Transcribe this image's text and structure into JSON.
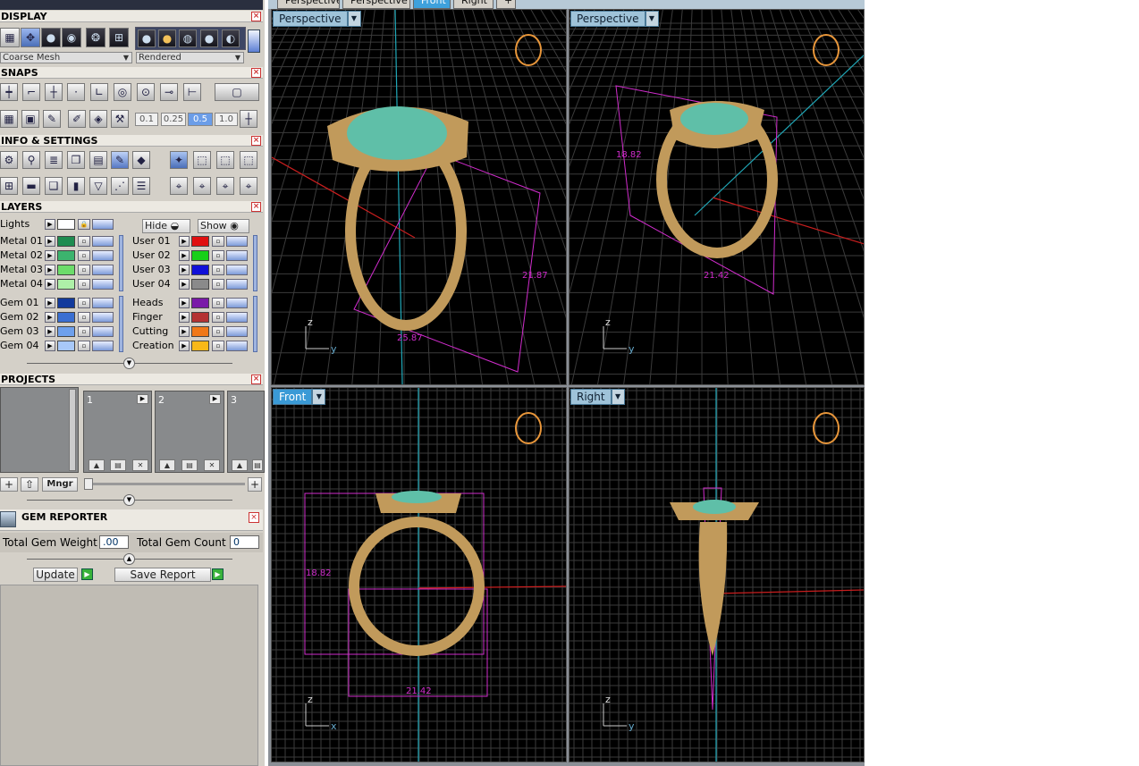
{
  "panels": {
    "display": "DISPLAY",
    "snaps": "SNAPS",
    "info": "INFO & SETTINGS",
    "layers": "LAYERS",
    "projects": "PROJECTS",
    "gem_reporter": "GEM REPORTER",
    "close": "×"
  },
  "display": {
    "mesh_select": "Coarse Mesh",
    "render_select": "Rendered"
  },
  "snaps": {
    "values": [
      "0.1",
      "0.25",
      "0.5",
      "1.0"
    ],
    "selected": "0.5"
  },
  "layers": {
    "lights_label": "Lights",
    "hide": "Hide",
    "show": "Show",
    "left": [
      {
        "name": "Metal 01",
        "color": "#1e8c50"
      },
      {
        "name": "Metal 02",
        "color": "#3cb46e"
      },
      {
        "name": "Metal 03",
        "color": "#6cdc6a"
      },
      {
        "name": "Metal 04",
        "color": "#aef0a8"
      },
      {
        "name": "Gem 01",
        "color": "#123a9c"
      },
      {
        "name": "Gem 02",
        "color": "#3a6fd2"
      },
      {
        "name": "Gem 03",
        "color": "#6ea0ec"
      },
      {
        "name": "Gem 04",
        "color": "#a8c8f8"
      }
    ],
    "right": [
      {
        "name": "User 01",
        "color": "#e01010"
      },
      {
        "name": "User 02",
        "color": "#18d018"
      },
      {
        "name": "User 03",
        "color": "#1010d8"
      },
      {
        "name": "User 04",
        "color": "#8a8a8a"
      },
      {
        "name": "Heads",
        "color": "#7a1aa8"
      },
      {
        "name": "Finger",
        "color": "#b43232"
      },
      {
        "name": "Cutting",
        "color": "#f07818"
      },
      {
        "name": "Creation",
        "color": "#f8b818"
      }
    ]
  },
  "projects": {
    "slots": [
      "1",
      "2",
      "3"
    ],
    "mngr": "Mngr",
    "plus": "+"
  },
  "gem_reporter": {
    "total_weight_label": "Total Gem Weight",
    "total_weight_value": ".00",
    "total_count_label": "Total Gem Count",
    "total_count_value": "0",
    "update": "Update",
    "save_report": "Save Report"
  },
  "tabs": [
    {
      "label": "Perspective",
      "active": false
    },
    {
      "label": "Perspective",
      "active": false
    },
    {
      "label": "Front",
      "active": true
    },
    {
      "label": "Right",
      "active": false
    },
    {
      "label": "+",
      "active": false
    }
  ],
  "viewports": [
    {
      "label": "Perspective",
      "active": false,
      "dims": [
        "21.87",
        "25.87"
      ],
      "axes": {
        "up": "z",
        "side": "y"
      }
    },
    {
      "label": "Perspective",
      "active": false,
      "dims": [
        "18.82",
        "21.42"
      ],
      "axes": {
        "up": "z",
        "side": "y"
      }
    },
    {
      "label": "Front",
      "active": true,
      "dims": [
        "18.82",
        "21.42"
      ],
      "axes": {
        "up": "z",
        "side": "x"
      }
    },
    {
      "label": "Right",
      "active": false,
      "dims": [],
      "axes": {
        "up": "z",
        "side": "y"
      }
    }
  ],
  "colors": {
    "metal": "#c19a5b",
    "gem": "#5fbfa8",
    "dimension": "#d02ccc",
    "axis_red": "#c81e1e",
    "axis_cyan": "#20a8b8",
    "grid": "#3b3b3b"
  }
}
